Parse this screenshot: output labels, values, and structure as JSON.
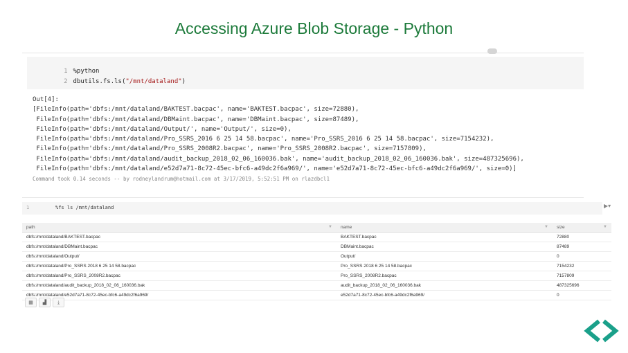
{
  "slide": {
    "title": "Accessing Azure Blob Storage - Python"
  },
  "cell1": {
    "code_lines": [
      {
        "num": "1",
        "text": "%python"
      },
      {
        "num": "2",
        "prefix": "dbutils.fs.ls(",
        "str": "\"/mnt/dataland\"",
        "suffix": ")"
      }
    ],
    "output_label": "Out[4]:",
    "output_lines": [
      "[FileInfo(path='dbfs:/mnt/dataland/BAKTEST.bacpac', name='BAKTEST.bacpac', size=72880),",
      " FileInfo(path='dbfs:/mnt/dataland/DBMaint.bacpac', name='DBMaint.bacpac', size=87489),",
      " FileInfo(path='dbfs:/mnt/dataland/Output/', name='Output/', size=0),",
      " FileInfo(path='dbfs:/mnt/dataland/Pro_SSRS_2016 6 25 14 58.bacpac', name='Pro_SSRS_2016 6 25 14 58.bacpac', size=7154232),",
      " FileInfo(path='dbfs:/mnt/dataland/Pro_SSRS_2008R2.bacpac', name='Pro_SSRS_2008R2.bacpac', size=7157809),",
      " FileInfo(path='dbfs:/mnt/dataland/audit_backup_2018_02_06_160036.bak', name='audit_backup_2018_02_06_160036.bak', size=487325696),",
      " FileInfo(path='dbfs:/mnt/dataland/e52d7a71-8c72-45ec-bfc6-a49dc2f6a969/', name='e52d7a71-8c72-45ec-bfc6-a49dc2f6a969/', size=0)]"
    ],
    "command_took": "Command took 0.14 seconds -- by rodneylandrum@hotmail.com at 3/17/2019, 5:52:51 PM on rlazdbcl1"
  },
  "cell2": {
    "line_num": "1",
    "command": "%fs ls /mnt/dataland",
    "run_icon": "run-arrow-icon",
    "columns": [
      "path",
      "name",
      "size"
    ],
    "rows": [
      [
        "dbfs:/mnt/dataland/BAKTEST.bacpac",
        "BAKTEST.bacpac",
        "72880"
      ],
      [
        "dbfs:/mnt/dataland/DBMaint.bacpac",
        "DBMaint.bacpac",
        "87489"
      ],
      [
        "dbfs:/mnt/dataland/Output/",
        "Output/",
        "0"
      ],
      [
        "dbfs:/mnt/dataland/Pro_SSRS 2018 6 25 14 58.bacpac",
        "Pro_SSRS 2018 6 25 14 58.bacpac",
        "7154232"
      ],
      [
        "dbfs:/mnt/dataland/Pro_SSRS_2008R2.bacpac",
        "Pro_SSRS_2008R2.bacpac",
        "7157809"
      ],
      [
        "dbfs:/mnt/dataland/audit_backup_2018_02_06_160036.bak",
        "audit_backup_2018_02_06_160036.bak",
        "487325696"
      ],
      [
        "dbfs:/mnt/dataland/e52d7a71-8c72-45ec-bfc6-a49dc2f6a969/",
        "e52d7a71-8c72-45ec-bfc6-a49dc2f6a969/",
        "0"
      ]
    ],
    "toolbar": [
      {
        "icon": "table-view-icon",
        "glyph": "▦"
      },
      {
        "icon": "bar-chart-icon",
        "glyph": "▟"
      },
      {
        "icon": "download-icon",
        "glyph": "⤓"
      }
    ]
  },
  "colors": {
    "title": "#1c7a3a",
    "nav_arrow": "#1aa08a"
  },
  "nav": {
    "prev_icon": "chevron-left-icon",
    "next_icon": "chevron-right-icon"
  }
}
